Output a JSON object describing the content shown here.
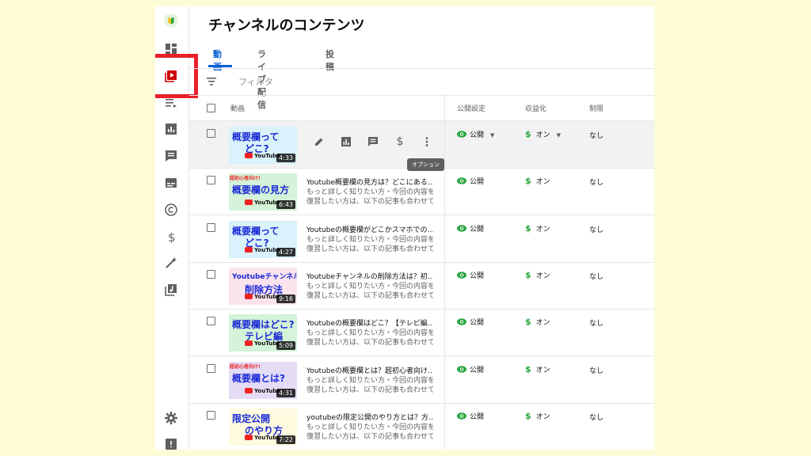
{
  "page": {
    "title": "チャンネルのコンテンツ"
  },
  "tabs": [
    {
      "label": "動画",
      "active": true
    },
    {
      "label": "ライブ配信",
      "active": false
    },
    {
      "label": "投稿",
      "active": false
    }
  ],
  "filter": {
    "placeholder": "フィルタ"
  },
  "columns": {
    "video": "動画",
    "visibility": "公開設定",
    "monetization": "収益化",
    "restrictions": "制限"
  },
  "tooltip": "オプション",
  "sidebar_icons": [
    "channel-avatar-icon",
    "dashboard-icon",
    "content-icon",
    "playlists-icon",
    "analytics-icon",
    "comments-icon",
    "subtitles-icon",
    "copyright-icon",
    "earn-icon",
    "customization-icon",
    "audio-library-icon",
    "settings-icon",
    "feedback-icon"
  ],
  "videos": [
    {
      "thumb_line1": "概要欄って",
      "thumb_line2": "どこ?",
      "thumb_tag": "",
      "thumb_bg": "#d9f2fb",
      "duration": "4:33",
      "title": "",
      "desc1": "",
      "desc2": "",
      "visibility": "公開",
      "monetization": "オン",
      "restriction": "なし"
    },
    {
      "thumb_line1": "概要欄の見方",
      "thumb_line2": "",
      "thumb_tag": "超初心者向け!",
      "thumb_bg": "#d4f3d8",
      "duration": "6:43",
      "title": "Youtube概要欄の見方は？どこにある…",
      "desc1": "もっと詳しく知りたい方・今回の内容を",
      "desc2": "復習したい方は、以下の記事も合わせて…",
      "visibility": "公開",
      "monetization": "オン",
      "restriction": "なし"
    },
    {
      "thumb_line1": "概要欄って",
      "thumb_line2": "どこ?",
      "thumb_tag": "",
      "thumb_bg": "#d9f2fb",
      "duration": "4:27",
      "title": "Youtubeの概要欄がどこかスマホでの…",
      "desc1": "もっと詳しく知りたい方・今回の内容を",
      "desc2": "復習したい方は、以下の記事も合わせて…",
      "visibility": "公開",
      "monetization": "オン",
      "restriction": "なし"
    },
    {
      "thumb_line1": "Youtubeチャンネルの",
      "thumb_line2": "削除方法",
      "thumb_tag": "",
      "thumb_bg": "#fbe3ee",
      "duration": "9:16",
      "title": "Youtubeチャンネルの削除方法は？初…",
      "desc1": "もっと詳しく知りたい方・今回の内容を",
      "desc2": "復習したい方は、以下の記事も合わせて…",
      "visibility": "公開",
      "monetization": "オン",
      "restriction": "なし"
    },
    {
      "thumb_line1": "概要欄はどこ?",
      "thumb_line2": "テレビ編",
      "thumb_tag": "",
      "thumb_bg": "#d4f3d8",
      "duration": "5:09",
      "title": "Youtubeの概要欄はどこ？【テレビ編…",
      "desc1": "もっと詳しく知りたい方・今回の内容を",
      "desc2": "復習したい方は、以下の記事も合わせて…",
      "visibility": "公開",
      "monetization": "オン",
      "restriction": "なし"
    },
    {
      "thumb_line1": "概要欄とは?",
      "thumb_line2": "",
      "thumb_tag": "超初心者向け!",
      "thumb_bg": "#e4dcf5",
      "duration": "4:31",
      "title": "Youtubeの概要欄とは？超初心者向け…",
      "desc1": "もっと詳しく知りたい方・今回の内容を",
      "desc2": "復習したい方は、以下の記事も合わせて…",
      "visibility": "公開",
      "monetization": "オン",
      "restriction": "なし"
    },
    {
      "thumb_line1": "限定公開",
      "thumb_line2": "のやり方",
      "thumb_tag": "",
      "thumb_bg": "#fffbe0",
      "duration": "7:22",
      "title": "youtubeの限定公開のやり方とは？方…",
      "desc1": "もっと詳しく知りたい方・今回の内容を",
      "desc2": "復習したい方は、以下の記事も合わせて…",
      "visibility": "公開",
      "monetization": "オン",
      "restriction": "なし"
    }
  ],
  "thumb_brand": "YouTube",
  "colors": {
    "accent": "#065fd4",
    "highlight_box": "#e8202a",
    "monetization": "#2ba640",
    "background": "#fdfcd6"
  }
}
